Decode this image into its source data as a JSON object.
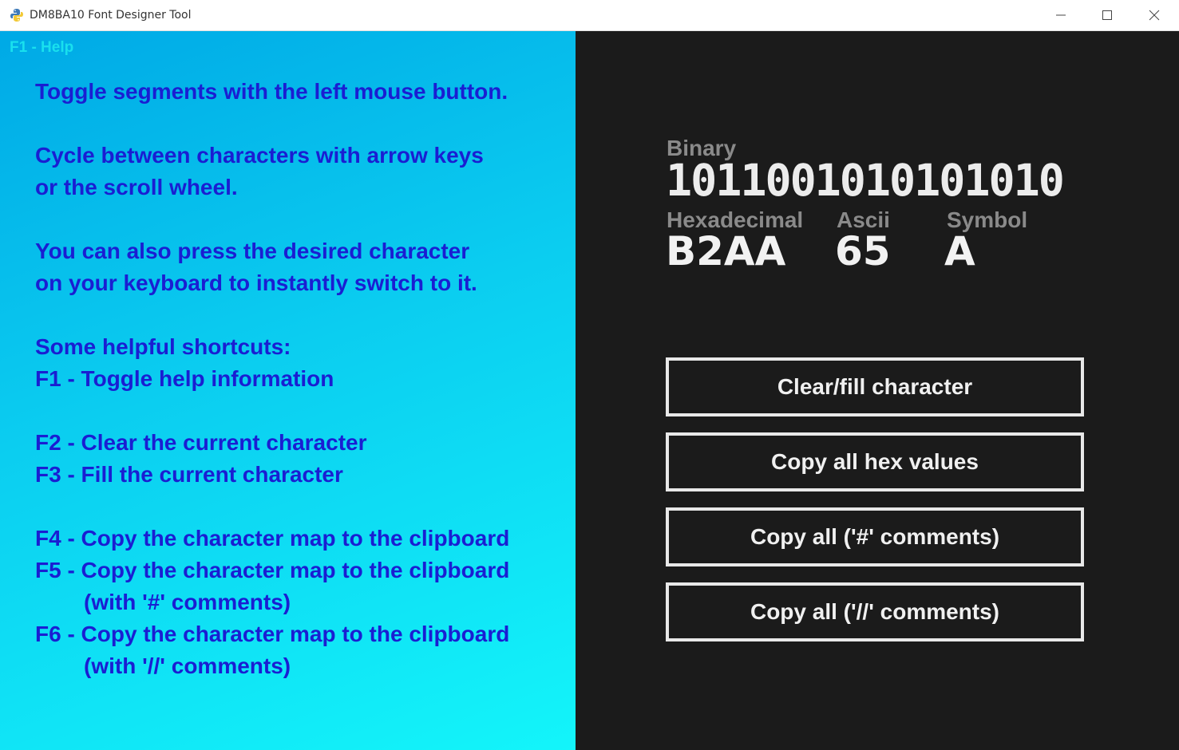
{
  "window": {
    "title": "DM8BA10 Font Designer Tool",
    "icon": "python-icon",
    "controls": [
      "minimize-icon",
      "maximize-icon",
      "close-icon"
    ]
  },
  "help": {
    "tab_label": "F1 - Help",
    "lines": [
      "Toggle segments with the left mouse button.",
      "Cycle between characters with arrow keys",
      "or the scroll wheel.",
      "You can also press the desired character",
      "on your keyboard to instantly switch to it.",
      "Some helpful shortcuts:",
      "F1 - Toggle help information",
      "F2 - Clear the current character",
      "F3 - Fill the current character",
      "F4 - Copy the character map to the clipboard",
      "F5 - Copy the character map to the clipboard",
      "(with '#' comments)",
      "F6 - Copy the character map to the clipboard",
      "(with '//' comments)"
    ]
  },
  "info": {
    "binary_label": "Binary",
    "binary_value": "1011001010101010",
    "hex_label": "Hexadecimal",
    "hex_value": "B2AA",
    "ascii_label": "Ascii",
    "ascii_value": "65",
    "symbol_label": "Symbol",
    "symbol_value": "A"
  },
  "buttons": {
    "clear_fill": "Clear/fill character",
    "copy_hex": "Copy all hex values",
    "copy_hash": "Copy all ('#' comments)",
    "copy_slash": "Copy all ('//' comments)"
  },
  "colors": {
    "help_text": "#1a1ed2",
    "help_bg_top": "#00a9e6",
    "help_bg_bottom": "#13f5fa",
    "dark_bg": "#1b1b1b",
    "label_gray": "#8a8a8a"
  }
}
